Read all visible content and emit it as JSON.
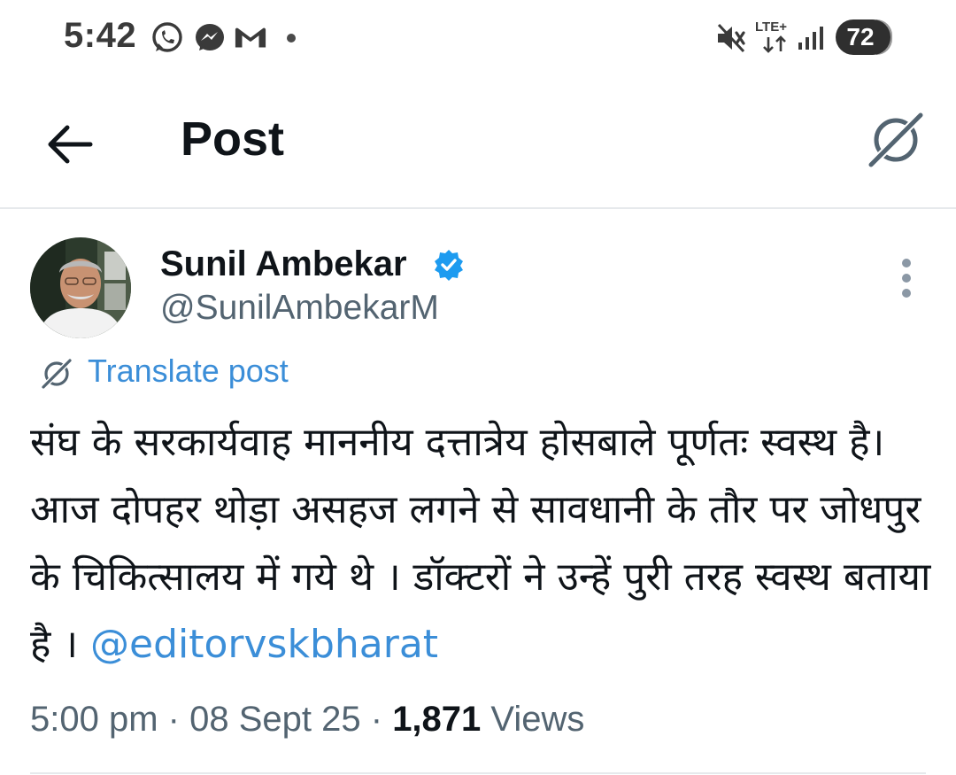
{
  "status_bar": {
    "time": "5:42",
    "network_label": "LTE+",
    "battery": "72",
    "app_icons": [
      "whatsapp-icon",
      "messenger-icon",
      "gmail-icon"
    ],
    "system_icons": [
      "mute-icon",
      "signal-icon"
    ]
  },
  "header": {
    "title": "Post",
    "back_icon": "back-arrow-icon",
    "grok_icon": "grok-icon"
  },
  "post": {
    "author_name": "Sunil Ambekar",
    "verified": true,
    "author_handle": "@SunilAmbekarM",
    "translate_label": "Translate post",
    "text": "संघ के सरकार्यवाह माननीय दत्तात्रेय होसबाले पूर्णतः स्वस्थ है। आज दोपहर थोड़ा असहज लगने से सावधानी के तौर पर जोधपुर के चिकित्सालय में गये थे । डॉक्टरों ने उन्हें पुरी तरह स्वस्थ बताया है ।",
    "mention": "@editorvskbharat",
    "time": "5:00 pm",
    "date": "08 Sept 25",
    "separator": "·",
    "views_count": "1,871",
    "views_label": "Views"
  },
  "colors": {
    "link": "#3b8ed8",
    "verified": "#1d9bf0",
    "secondary_text": "#536471",
    "primary_text": "#0f1419"
  }
}
